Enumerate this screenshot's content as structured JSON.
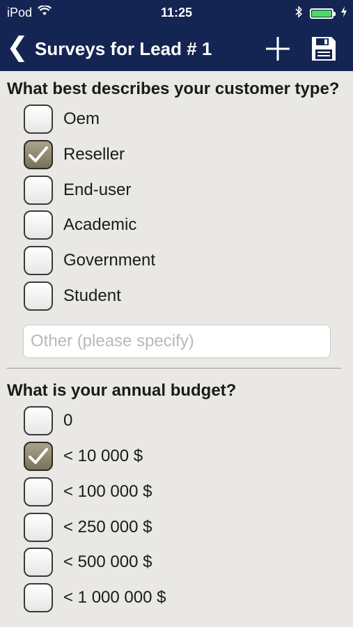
{
  "status": {
    "carrier": "iPod",
    "time": "11:25",
    "battery_level": 1.0
  },
  "nav": {
    "title": "Surveys for Lead # 1",
    "back_icon": "chevron-left-icon",
    "add_icon": "plus-icon",
    "save_icon": "floppy-disk-icon"
  },
  "colors": {
    "navbar": "#142453",
    "background": "#E9E8E4",
    "checked": "#8E8870"
  },
  "questions": [
    {
      "text": "What best describes your customer type?",
      "options": [
        {
          "label": "Oem",
          "checked": false
        },
        {
          "label": "Reseller",
          "checked": true
        },
        {
          "label": "End-user",
          "checked": false
        },
        {
          "label": "Academic",
          "checked": false
        },
        {
          "label": "Government",
          "checked": false
        },
        {
          "label": "Student",
          "checked": false
        }
      ],
      "other_placeholder": "Other (please specify)",
      "other_value": ""
    },
    {
      "text": "What is your annual budget?",
      "options": [
        {
          "label": "0",
          "checked": false
        },
        {
          "label": "< 10 000 $",
          "checked": true
        },
        {
          "label": "< 100 000 $",
          "checked": false
        },
        {
          "label": "< 250 000 $",
          "checked": false
        },
        {
          "label": "< 500 000 $",
          "checked": false
        },
        {
          "label": "< 1 000 000 $",
          "checked": false
        }
      ]
    }
  ]
}
